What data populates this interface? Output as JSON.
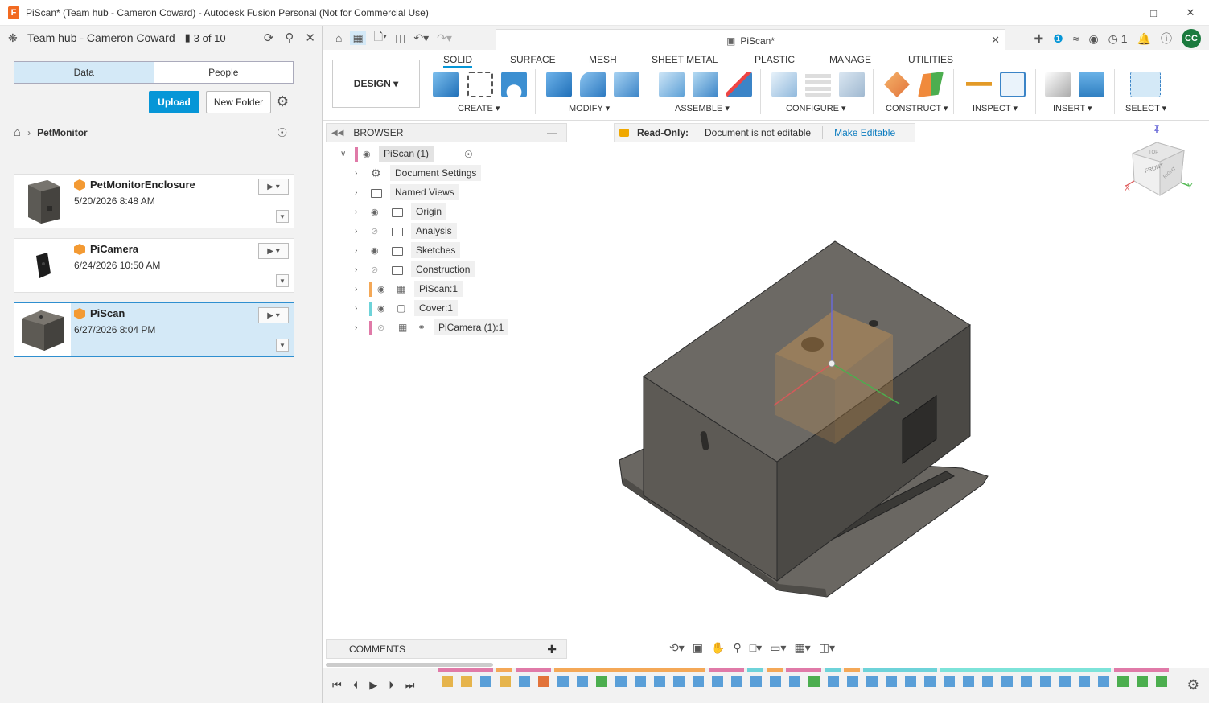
{
  "window": {
    "title": "PiScan* (Team hub - Cameron Coward) - Autodesk Fusion Personal (Not for Commercial Use)",
    "logo_letter": "F"
  },
  "data_panel": {
    "hub_name": "Team hub - Cameron Coward",
    "hub_count": "3 of 10",
    "tabs": [
      "Data",
      "People"
    ],
    "upload_label": "Upload",
    "new_folder_label": "New Folder",
    "breadcrumb": "PetMonitor",
    "files": [
      {
        "name": "PetMonitorEnclosure",
        "date": "5/20/2026 8:48 AM"
      },
      {
        "name": "PiCamera",
        "date": "6/24/2026 10:50 AM"
      },
      {
        "name": "PiScan",
        "date": "6/27/2026 8:04 PM"
      }
    ]
  },
  "doc_tab": {
    "title": "PiScan*"
  },
  "toolbar": {
    "job_count": "1",
    "avatar": "CC"
  },
  "ribbon": {
    "workspace": "DESIGN",
    "tabs": [
      "SOLID",
      "SURFACE",
      "MESH",
      "SHEET METAL",
      "PLASTIC",
      "MANAGE",
      "UTILITIES"
    ],
    "groups": [
      "CREATE",
      "MODIFY",
      "ASSEMBLE",
      "CONFIGURE",
      "CONSTRUCT",
      "INSPECT",
      "INSERT",
      "SELECT"
    ]
  },
  "browser": {
    "title": "BROWSER",
    "root": "PiScan (1)",
    "items": [
      "Document Settings",
      "Named Views",
      "Origin",
      "Analysis",
      "Sketches",
      "Construction",
      "PiScan:1",
      "Cover:1",
      "PiCamera (1):1"
    ]
  },
  "readonly": {
    "label": "Read-Only:",
    "message": "Document is not editable",
    "action": "Make Editable"
  },
  "viewcube": {
    "front": "FRONT",
    "top": "TOP",
    "right": "RIGHT",
    "z": "Z",
    "x": "X",
    "y": "Y"
  },
  "comments": {
    "title": "COMMENTS"
  }
}
